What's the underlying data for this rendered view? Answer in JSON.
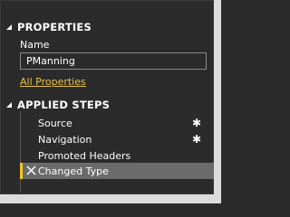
{
  "properties": {
    "header": "PROPERTIES",
    "name_label": "Name",
    "name_value": "PManning",
    "all_properties_link": "All Properties"
  },
  "applied_steps": {
    "header": "APPLIED STEPS",
    "steps": [
      {
        "label": "Source",
        "has_settings": true,
        "selected": false
      },
      {
        "label": "Navigation",
        "has_settings": true,
        "selected": false
      },
      {
        "label": "Promoted Headers",
        "has_settings": false,
        "selected": false
      },
      {
        "label": "Changed Type",
        "has_settings": false,
        "selected": true
      }
    ]
  },
  "colors": {
    "background": "#2b2b2b",
    "link": "#e8c24a",
    "selected_bg": "#6b6b6b",
    "selected_accent": "#f0c81c"
  },
  "icons": {
    "collapse": "triangle-collapse-icon",
    "settings": "gear-icon",
    "delete": "close-icon"
  }
}
